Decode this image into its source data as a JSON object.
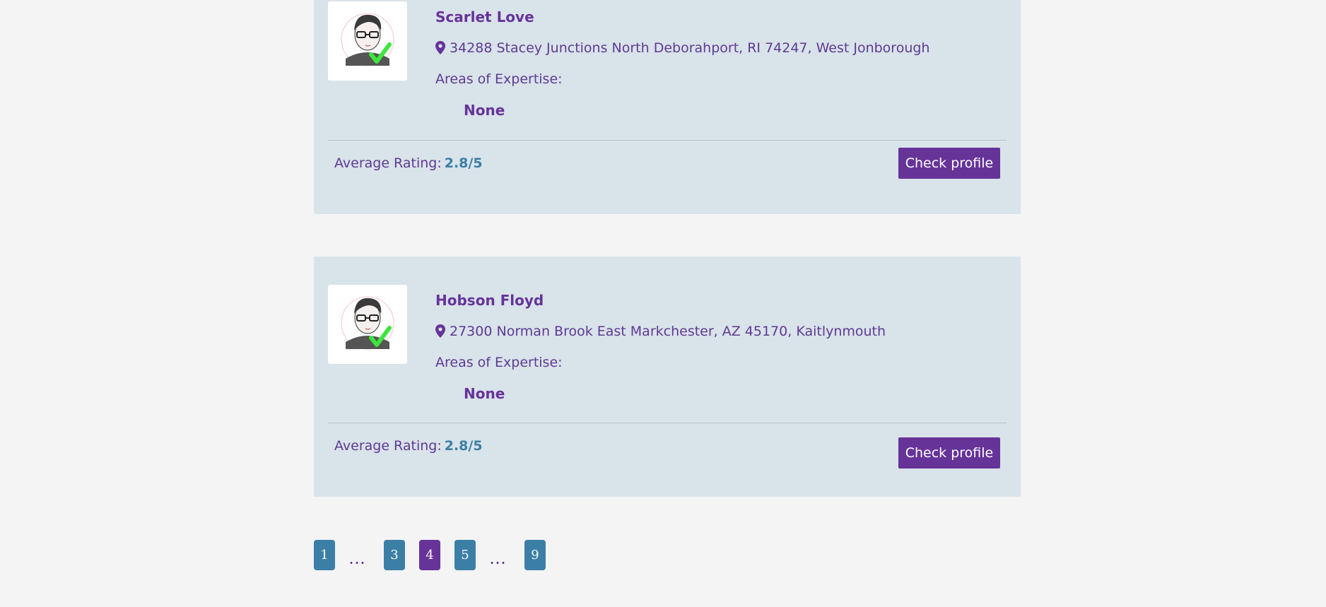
{
  "profiles": [
    {
      "name": "Scarlet Love",
      "address": "34288 Stacey Junctions North Deborahport, RI 74247, West Jonborough",
      "expertise_label": "Areas of Expertise:",
      "expertise_value": "None",
      "rating_label": "Average Rating:",
      "rating_value": "2.8/5",
      "button_label": "Check profile"
    },
    {
      "name": "Hobson Floyd",
      "address": "27300 Norman Brook East Markchester, AZ 45170, Kaitlynmouth",
      "expertise_label": "Areas of Expertise:",
      "expertise_value": "None",
      "rating_label": "Average Rating:",
      "rating_value": "2.8/5",
      "button_label": "Check profile"
    }
  ],
  "pagination": {
    "items": [
      "1",
      "…",
      "3",
      "4",
      "5",
      "…",
      "9"
    ],
    "active": "4"
  },
  "icons": {
    "avatar": "verified-avatar-icon",
    "location": "map-marker-icon"
  },
  "colors": {
    "accent": "#663399",
    "rating": "#3b7fa6",
    "page_button": "#3b7fa6",
    "card_bg": "#d9e3ea",
    "page_bg": "#f4f4f4",
    "verified_check": "#3ce63c"
  }
}
